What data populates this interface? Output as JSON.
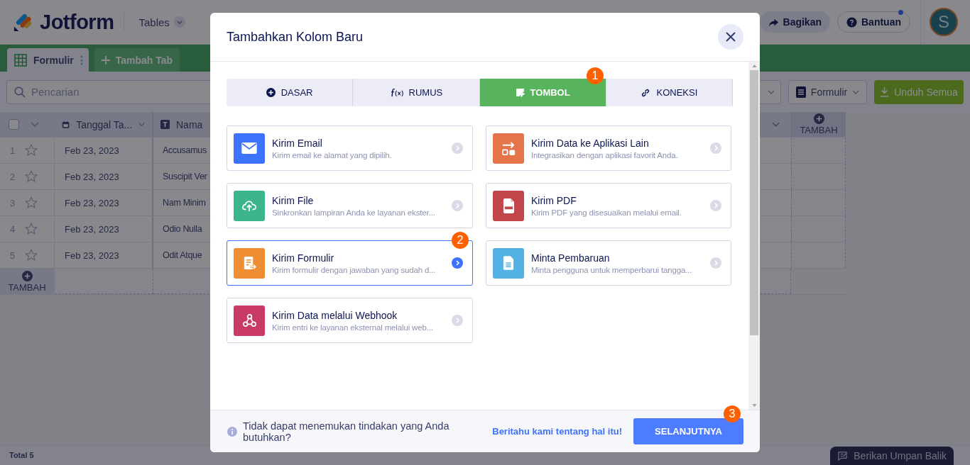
{
  "header": {
    "logo": "Jotform",
    "product": "Tables",
    "share": "Bagikan",
    "help": "Bantuan",
    "help_notification": true,
    "avatar": "S"
  },
  "tabs": [
    {
      "label": "Formulir",
      "selected": true
    }
  ],
  "add_tab": "Tambah Tab",
  "toolbar": {
    "search_placeholder": "Pencarian",
    "view_dropdown": "Formulir",
    "download": "Unduh Semua"
  },
  "table": {
    "select_all_checked": false,
    "columns": [
      "Tanggal Ta...",
      "Nama"
    ],
    "rows": [
      {
        "number": "1",
        "starred": false,
        "date": "Feb 23, 2023",
        "name": "Accusamus"
      },
      {
        "number": "2",
        "starred": false,
        "date": "Feb 23, 2023",
        "name": "Suscipit Ver"
      },
      {
        "number": "3",
        "starred": false,
        "date": "Feb 23, 2023",
        "name": "Nam Minim"
      },
      {
        "number": "4",
        "starred": false,
        "date": "Feb 23, 2023",
        "name": "Odio Nulla"
      },
      {
        "number": "5",
        "starred": false,
        "date": "Feb 23, 2023",
        "name": "Odit Atque"
      }
    ],
    "add_column": "TAMBAH",
    "add_row": "TAMBAH",
    "total": "Total 5"
  },
  "feedback": "Berikan Umpan Balik",
  "modal": {
    "title": "Tambahkan Kolom Baru",
    "tabs": [
      {
        "label": "DASAR",
        "selected": false
      },
      {
        "label": "RUMUS",
        "selected": false
      },
      {
        "label": "TOMBOL",
        "selected": true,
        "badge": "1"
      },
      {
        "label": "KONEKSI",
        "selected": false
      }
    ],
    "cards": [
      {
        "title": "Kirim Email",
        "description": "Kirim email ke alamat yang dipilih.",
        "color": "#3d72ff",
        "selected": false
      },
      {
        "title": "Kirim Data ke Aplikasi Lain",
        "description": "Integrasikan dengan aplikasi favorit Anda.",
        "color": "#e5744a",
        "selected": false
      },
      {
        "title": "Kirim File",
        "description": "Sinkronkan lampiran Anda ke layanan ekster...",
        "color": "#3cb48c",
        "selected": false
      },
      {
        "title": "Kirim PDF",
        "description": "Kirim PDF yang disesuaikan melalui email.",
        "color": "#c0464b",
        "selected": false
      },
      {
        "title": "Kirim Formulir",
        "description": "Kirim formulir dengan jawaban yang sudah d...",
        "color": "#ef8d33",
        "selected": true,
        "badge": "2"
      },
      {
        "title": "Minta Pembaruan",
        "description": "Minta pengguna untuk memperbarui tangga...",
        "color": "#53b1e4",
        "selected": false
      },
      {
        "title": "Kirim Data melalui Webhook",
        "description": "Kirim entri ke layanan eksternal melalui web...",
        "color": "#c93a64",
        "selected": false
      }
    ],
    "footer": {
      "hint": "Tidak dapat menemukan tindakan yang Anda butuhkan?",
      "link": "Beritahu kami tentang hal itu!",
      "next": "SELANJUTNYA",
      "next_badge": "3"
    }
  }
}
